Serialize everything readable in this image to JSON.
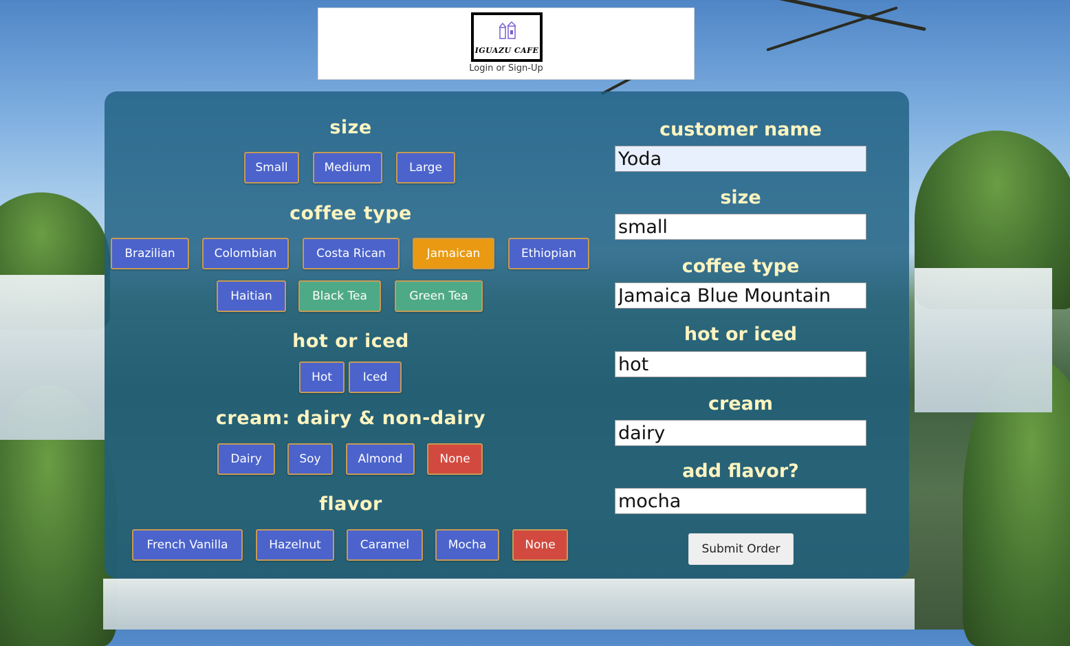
{
  "header": {
    "logo_text": "IGUAZU CAFE",
    "login_link": "Login or Sign-Up"
  },
  "builder": {
    "size_title": "size",
    "size_options": [
      "Small",
      "Medium",
      "Large"
    ],
    "coffee_title": "coffee type",
    "coffee_options": [
      "Brazilian",
      "Colombian",
      "Costa Rican",
      "Jamaican",
      "Ethiopian",
      "Haitian",
      "Black Tea",
      "Green Tea"
    ],
    "coffee_selected": "Jamaican",
    "temp_title": "hot or iced",
    "temp_options": [
      "Hot",
      "Iced"
    ],
    "cream_title": "cream: dairy & non-dairy",
    "cream_options": [
      "Dairy",
      "Soy",
      "Almond",
      "None"
    ],
    "flavor_title": "flavor",
    "flavor_options": [
      "French Vanilla",
      "Hazelnut",
      "Caramel",
      "Mocha",
      "None"
    ]
  },
  "order_form": {
    "customer_label": "customer name",
    "customer_value": "Yoda",
    "size_label": "size",
    "size_value": "small",
    "coffee_label": "coffee type",
    "coffee_value": "Jamaica Blue Mountain",
    "temp_label": "hot or iced",
    "temp_value": "hot",
    "cream_label": "cream",
    "cream_value": "dairy",
    "flavor_label": "add flavor?",
    "flavor_value": "mocha",
    "submit_label": "Submit Order"
  },
  "colors": {
    "button_blue": "#4b63cb",
    "button_selected": "#e99a12",
    "button_tea": "#4eaa86",
    "button_none": "#d24a3f",
    "title_cream": "#fcf4c0",
    "panel_teal": "#1e5f80"
  }
}
